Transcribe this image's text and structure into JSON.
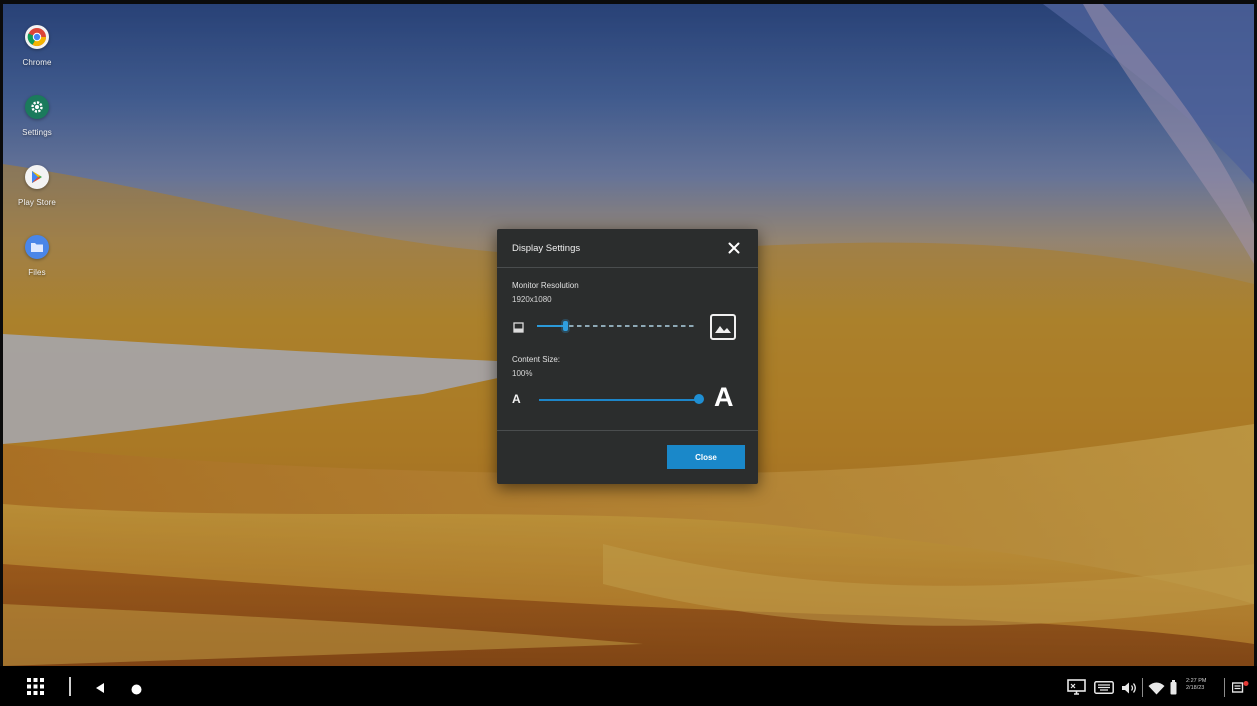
{
  "desktop": {
    "icons": [
      {
        "label": "Chrome",
        "icon": "chrome-icon"
      },
      {
        "label": "Settings",
        "icon": "settings-icon"
      },
      {
        "label": "Play Store",
        "icon": "play-store-icon"
      },
      {
        "label": "Files",
        "icon": "files-icon"
      }
    ]
  },
  "dialog": {
    "title": "Display Settings",
    "close_icon": "close-icon",
    "monitor_resolution": {
      "label": "Monitor Resolution",
      "value": "1920x1080",
      "slider_level": 0.17,
      "min_icon": "small-screen-icon",
      "max_icon": "large-image-icon"
    },
    "content_size": {
      "label": "Content Size:",
      "value": "100%",
      "slider_level": 1.0,
      "small_glyph": "A",
      "large_glyph": "A"
    },
    "close_button": "Close",
    "accent_color": "#1a88c9"
  },
  "taskbar": {
    "launcher_icon": "app-grid-icon",
    "back_icon": "back-icon",
    "home_icon": "home-icon",
    "tray": {
      "icons": [
        "screen-cast-icon",
        "keyboard-icon",
        "volume-icon",
        "wifi-icon",
        "battery-icon",
        "notification-icon"
      ],
      "time": "2:27 PM",
      "date": "2/18/23"
    }
  }
}
